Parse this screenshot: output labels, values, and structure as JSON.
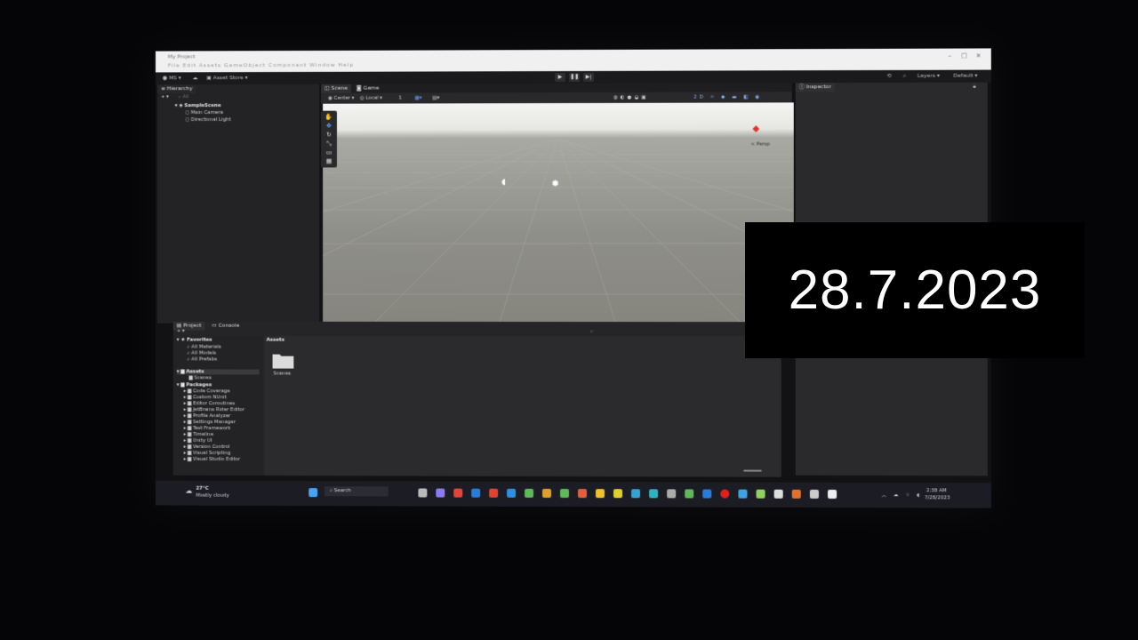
{
  "window": {
    "title": "My Project",
    "menu_text": "File Edit Assets GameObject Component Window Help"
  },
  "toolbar": {
    "account_label": "MS",
    "asset_store_label": "Asset Store",
    "layers_label": "Layers",
    "layout_label": "Default"
  },
  "hierarchy": {
    "tab_label": "Hierarchy",
    "search_placeholder": "All",
    "scene_name": "SampleScene",
    "objects": [
      "Main Camera",
      "Directional Light"
    ]
  },
  "scene_view": {
    "tabs": [
      "Scene",
      "Game"
    ],
    "pivot_label": "Center",
    "space_label": "Local",
    "grid_value": "1",
    "camera_label": "< Persp"
  },
  "inspector": {
    "tab_label": "Inspector"
  },
  "project": {
    "tabs": [
      "Project",
      "Console"
    ],
    "favorites_label": "Favorites",
    "favorites": [
      "All Materials",
      "All Models",
      "All Prefabs"
    ],
    "assets_label": "Assets",
    "assets_children": [
      "Scenes"
    ],
    "packages_label": "Packages",
    "packages": [
      "Code Coverage",
      "Custom NUnit",
      "Editor Coroutines",
      "JetBrains Rider Editor",
      "Profile Analyzer",
      "Settings Manager",
      "Test Framework",
      "Timeline",
      "Unity UI",
      "Version Control",
      "Visual Scripting",
      "Visual Studio Editor"
    ],
    "breadcrumb": "Assets",
    "folder_items": [
      "Scenes"
    ]
  },
  "taskbar": {
    "weather_temp": "27°C",
    "weather_desc": "Mostly cloudy",
    "search_label": "Search",
    "time": "2:38 AM",
    "date": "7/28/2023"
  },
  "overlay": {
    "date_text": "28.7.2023"
  }
}
